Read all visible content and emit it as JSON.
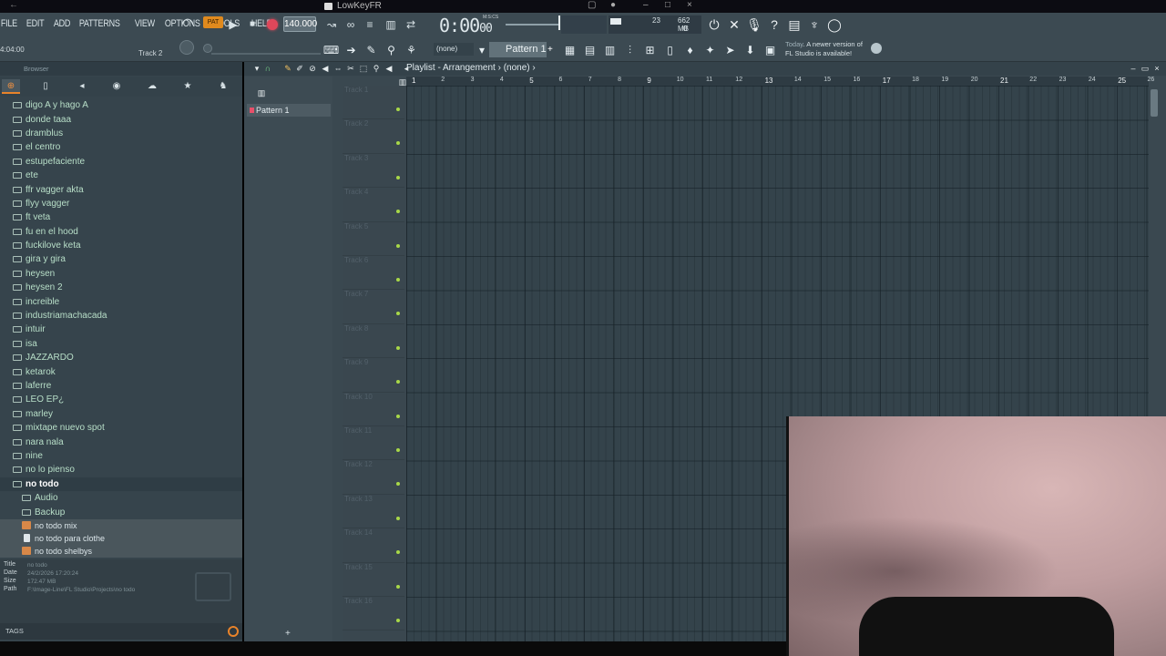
{
  "window": {
    "title": "LowKeyFR"
  },
  "menu": [
    "FILE",
    "EDIT",
    "ADD",
    "PATTERNS",
    "VIEW",
    "OPTIONS",
    "TOOLS",
    "HELP"
  ],
  "transport": {
    "pattern_mode": "PAT",
    "tempo": "140.000",
    "time": "0:00",
    "time_small": "00",
    "mics_label": "M:S:CS"
  },
  "cpu": {
    "value": "23",
    "memory": "662 MB",
    "polyphony": "0"
  },
  "hint": {
    "position": "4:04:00",
    "track": "Track 2"
  },
  "patterns": {
    "none_label": "(none)",
    "current": "Pattern 1"
  },
  "news": {
    "today": "Today",
    "line1": "A newer version of",
    "line2": "FL Studio is available!"
  },
  "browser": {
    "header": "Browser",
    "items": [
      {
        "label": "digo A y hago A",
        "type": "folder"
      },
      {
        "label": "donde taaa",
        "type": "folder"
      },
      {
        "label": "dramblus",
        "type": "folder"
      },
      {
        "label": "el centro",
        "type": "folder"
      },
      {
        "label": "estupefaciente",
        "type": "folder"
      },
      {
        "label": "ete",
        "type": "folder"
      },
      {
        "label": "ffr vagger akta",
        "type": "folder"
      },
      {
        "label": "flyy vagger",
        "type": "folder"
      },
      {
        "label": "ft veta",
        "type": "folder"
      },
      {
        "label": "fu en el hood",
        "type": "folder"
      },
      {
        "label": "fuckilove keta",
        "type": "folder"
      },
      {
        "label": "gira y gira",
        "type": "folder"
      },
      {
        "label": "heysen",
        "type": "folder"
      },
      {
        "label": "heysen 2",
        "type": "folder"
      },
      {
        "label": "increible",
        "type": "folder"
      },
      {
        "label": "industriamachacada",
        "type": "folder"
      },
      {
        "label": "intuir",
        "type": "folder"
      },
      {
        "label": "isa",
        "type": "folder"
      },
      {
        "label": "JAZZARDO",
        "type": "folder"
      },
      {
        "label": "ketarok",
        "type": "folder"
      },
      {
        "label": "laferre",
        "type": "folder"
      },
      {
        "label": "LEO EP¿",
        "type": "folder"
      },
      {
        "label": "marley",
        "type": "folder"
      },
      {
        "label": "mixtape nuevo spot",
        "type": "folder"
      },
      {
        "label": "nara nala",
        "type": "folder"
      },
      {
        "label": "nine",
        "type": "folder"
      },
      {
        "label": "no lo pienso",
        "type": "folder"
      },
      {
        "label": "no todo",
        "type": "folder-open"
      },
      {
        "label": "Audio",
        "type": "subfolder"
      },
      {
        "label": "Backup",
        "type": "subfolder"
      },
      {
        "label": "no todo mix",
        "type": "project"
      },
      {
        "label": "no todo para clothe",
        "type": "doc"
      },
      {
        "label": "no todo shelbys",
        "type": "project"
      }
    ],
    "info": {
      "title_key": "Title",
      "title_val": "no todo",
      "date_key": "Date",
      "date_val": "24/2/2026 17:20:24",
      "size_key": "Size",
      "size_val": "172.47 MB",
      "path_key": "Path",
      "path_val": "F:\\Image-Line\\FL Studio\\Projects\\no todo"
    },
    "tags_label": "TAGS"
  },
  "playlist": {
    "title": "Playlist - Arrangement",
    "selection": "(none)",
    "pattern_item": "Pattern 1",
    "tracks": [
      "Track 1",
      "Track 2",
      "Track 3",
      "Track 4",
      "Track 5",
      "Track 6",
      "Track 7",
      "Track 8",
      "Track 9",
      "Track 10",
      "Track 11",
      "Track 12",
      "Track 13",
      "Track 14",
      "Track 15",
      "Track 16"
    ],
    "bars": [
      "1",
      "2",
      "3",
      "4",
      "5",
      "6",
      "7",
      "8",
      "9",
      "10",
      "11",
      "12",
      "13",
      "14",
      "15",
      "16",
      "17",
      "18",
      "19",
      "20",
      "21",
      "22",
      "23",
      "24",
      "25",
      "26"
    ]
  }
}
